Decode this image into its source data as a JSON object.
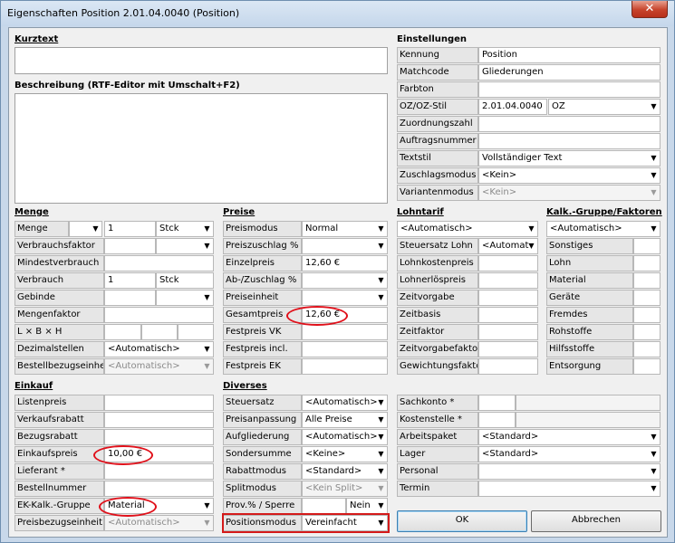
{
  "window": {
    "title": "Eigenschaften Position 2.01.04.0040 (Position)",
    "close_glyph": "✕"
  },
  "kurztext": {
    "heading": "Kurztext",
    "value": ""
  },
  "beschreibung": {
    "heading": "Beschreibung (RTF-Editor mit Umschalt+F2)",
    "value": ""
  },
  "einstellungen": {
    "heading": "Einstellungen",
    "kennung": {
      "label": "Kennung",
      "value": "Position"
    },
    "matchcode": {
      "label": "Matchcode",
      "value": "Gliederungen"
    },
    "farbton": {
      "label": "Farbton",
      "value": ""
    },
    "oz": {
      "label": "OZ/OZ-Stil",
      "value": "2.01.04.0040",
      "stil": "OZ"
    },
    "zuordnungszahl": {
      "label": "Zuordnungszahl",
      "value": ""
    },
    "auftragsnummer": {
      "label": "Auftragsnummer",
      "value": ""
    },
    "textstil": {
      "label": "Textstil",
      "value": "Vollständiger Text"
    },
    "zuschlagsmodus": {
      "label": "Zuschlagsmodus",
      "value": "<Kein>"
    },
    "variantenmodus": {
      "label": "Variantenmodus",
      "value": "<Kein>"
    }
  },
  "menge": {
    "heading": "Menge",
    "menge": {
      "label": "Menge",
      "value": "1",
      "unit": "Stck"
    },
    "verbrauchsfaktor": {
      "label": "Verbrauchsfaktor",
      "value": ""
    },
    "mindestverbrauch": {
      "label": "Mindestverbrauch",
      "value": ""
    },
    "verbrauch": {
      "label": "Verbrauch",
      "value": "1",
      "unit": "Stck"
    },
    "gebinde": {
      "label": "Gebinde",
      "value": ""
    },
    "mengenfaktor": {
      "label": "Mengenfaktor",
      "value": ""
    },
    "lbh": {
      "label": "L × B × H",
      "value": ""
    },
    "dezimalstellen": {
      "label": "Dezimalstellen",
      "value": "<Automatisch>"
    },
    "bestellbezugseinheit": {
      "label": "Bestellbezugseinheit",
      "value": "<Automatisch>"
    }
  },
  "preise": {
    "heading": "Preise",
    "preismodus": {
      "label": "Preismodus",
      "value": "Normal"
    },
    "preiszuschlag": {
      "label": "Preiszuschlag %",
      "value": ""
    },
    "einzelpreis": {
      "label": "Einzelpreis",
      "value": "12,60 €"
    },
    "abzuschlag": {
      "label": "Ab-/Zuschlag %",
      "value": ""
    },
    "preiseinheit": {
      "label": "Preiseinheit",
      "value": ""
    },
    "gesamtpreis": {
      "label": "Gesamtpreis",
      "value": "12,60 €"
    },
    "festpreisvk": {
      "label": "Festpreis VK",
      "value": ""
    },
    "festpreisincl": {
      "label": "Festpreis incl.",
      "value": ""
    },
    "festpreisek": {
      "label": "Festpreis EK",
      "value": ""
    }
  },
  "lohntarif": {
    "heading": "Lohntarif",
    "tarif": "<Automatisch>",
    "steuersatz": {
      "label": "Steuersatz Lohn",
      "value": "<Automat"
    },
    "lohnkostenpreis": {
      "label": "Lohnkostenpreis",
      "value": ""
    },
    "lohnerloespreis": {
      "label": "Lohnerlöspreis",
      "value": ""
    },
    "zeitvorgabe": {
      "label": "Zeitvorgabe",
      "value": ""
    },
    "zeitbasis": {
      "label": "Zeitbasis",
      "value": ""
    },
    "zeitfaktor": {
      "label": "Zeitfaktor",
      "value": ""
    },
    "zeitvorgabefaktor": {
      "label": "Zeitvorgabefaktor",
      "value": ""
    },
    "gewichtungsfaktor": {
      "label": "Gewichtungsfaktor",
      "value": ""
    }
  },
  "kalk": {
    "heading": "Kalk.-Gruppe/Faktoren",
    "gruppe": "<Automatisch>",
    "sonstiges": {
      "label": "Sonstiges",
      "value": ""
    },
    "lohn": {
      "label": "Lohn",
      "value": ""
    },
    "material": {
      "label": "Material",
      "value": ""
    },
    "geraete": {
      "label": "Geräte",
      "value": ""
    },
    "fremdes": {
      "label": "Fremdes",
      "value": ""
    },
    "rohstoffe": {
      "label": "Rohstoffe",
      "value": ""
    },
    "hilfsstoffe": {
      "label": "Hilfsstoffe",
      "value": ""
    },
    "entsorgung": {
      "label": "Entsorgung",
      "value": ""
    }
  },
  "einkauf": {
    "heading": "Einkauf",
    "listenpreis": {
      "label": "Listenpreis",
      "value": ""
    },
    "verkaufsrabatt": {
      "label": "Verkaufsrabatt",
      "value": ""
    },
    "bezugsrabatt": {
      "label": "Bezugsrabatt",
      "value": ""
    },
    "einkaufspreis": {
      "label": "Einkaufspreis",
      "value": "10,00 €"
    },
    "lieferant": {
      "label": "Lieferant *",
      "value": ""
    },
    "bestellnummer": {
      "label": "Bestellnummer",
      "value": ""
    },
    "ekgruppe": {
      "label": "EK-Kalk.-Gruppe",
      "value": "Material"
    },
    "preisbezugseinheit": {
      "label": "Preisbezugseinheit",
      "value": "<Automatisch>"
    }
  },
  "diverses": {
    "heading": "Diverses",
    "steuersatz": {
      "label": "Steuersatz",
      "value": "<Automatisch>"
    },
    "preisanpassung": {
      "label": "Preisanpassung",
      "value": "Alle Preise"
    },
    "aufgliederung": {
      "label": "Aufgliederung",
      "value": "<Automatisch>"
    },
    "sondersumme": {
      "label": "Sondersumme",
      "value": "<Keine>"
    },
    "rabattmodus": {
      "label": "Rabattmodus",
      "value": "<Standard>"
    },
    "splitmodus": {
      "label": "Splitmodus",
      "value": "<Kein Split>"
    },
    "prov": {
      "label": "Prov.% / Sperre",
      "value": "",
      "sperre": "Nein"
    },
    "positionsmodus": {
      "label": "Positionsmodus",
      "value": "Vereinfacht"
    }
  },
  "konten": {
    "sachkonto": {
      "label": "Sachkonto *",
      "value": ""
    },
    "kostenstelle": {
      "label": "Kostenstelle *",
      "value": ""
    },
    "arbeitspaket": {
      "label": "Arbeitspaket",
      "value": "<Standard>"
    },
    "lager": {
      "label": "Lager",
      "value": "<Standard>"
    },
    "personal": {
      "label": "Personal",
      "value": ""
    },
    "termin": {
      "label": "Termin",
      "value": ""
    }
  },
  "buttons": {
    "ok": "OK",
    "abbrechen": "Abbrechen"
  },
  "icons": {
    "dropdown": "▼"
  },
  "colors": {
    "highlight": "#e0101a"
  }
}
